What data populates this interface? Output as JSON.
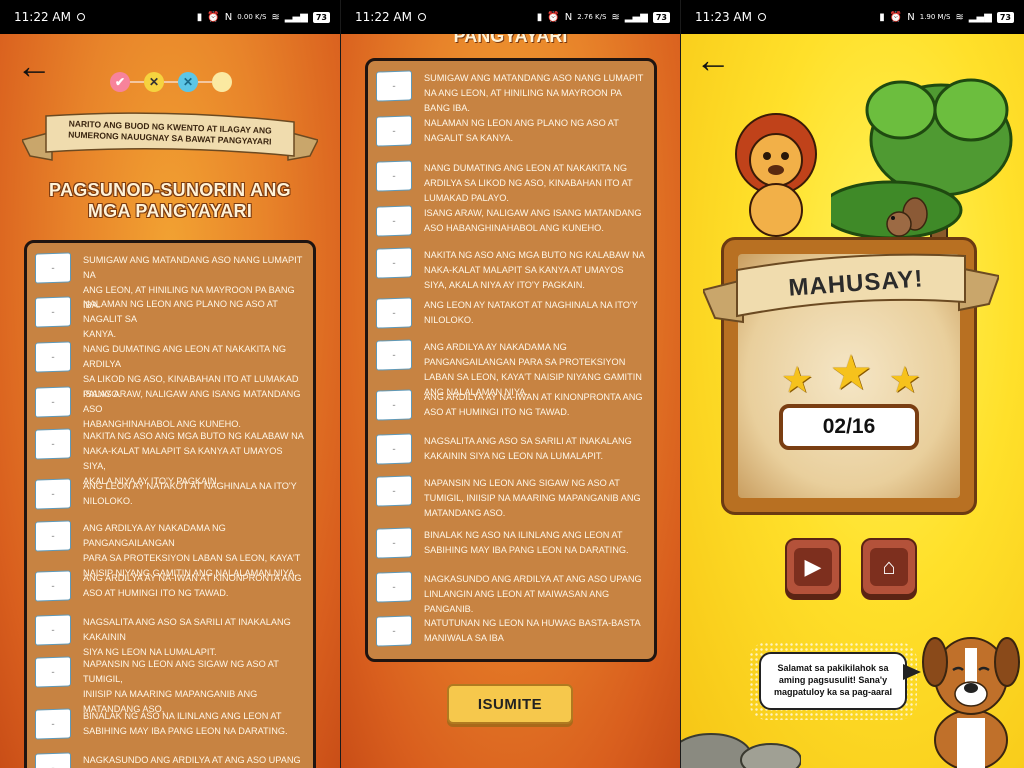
{
  "screens": [
    {
      "status": {
        "time": "11:22 AM",
        "speed": "0.00 K/S",
        "battery": "73"
      },
      "progress": [
        {
          "state": "check",
          "symbol": "✔"
        },
        {
          "state": "wrong",
          "symbol": "✕"
        },
        {
          "state": "wrong",
          "symbol": "✕"
        },
        {
          "state": "current",
          "symbol": ""
        }
      ],
      "banner_text": "NARITO ANG BUOD NG KWENTO AT ILAGAY ANG NUMERONG NAUUGNAY SA BAWAT PANGYAYARI",
      "title_line1": "PAGSUNOD-SUNORIN ANG",
      "title_line2": "MGA PANGYAYARI"
    },
    {
      "status": {
        "time": "11:22 AM",
        "speed": "2.76 K/S",
        "battery": "73"
      },
      "title_fragment": "PANGYAYARI",
      "submit_label": "ISUMITE"
    },
    {
      "status": {
        "time": "11:23 AM",
        "speed": "1.90 M/S",
        "battery": "73"
      },
      "heading": "MAHUSAY!",
      "stars": 3,
      "score": "02/16",
      "speech": "Salamat sa pakikilahok sa aming pagsusulit! Sana'y magpatuloy ka sa pag-aaral"
    }
  ],
  "slot_placeholder": "-",
  "events": [
    "SUMIGAW ANG MATANDANG ASO NANG LUMAPIT NA ANG LEON, AT HINILING NA MAYROON PA BANG IBA.",
    "NALAMAN NG LEON ANG PLANO NG ASO AT NAGALIT SA KANYA.",
    "NANG DUMATING ANG LEON AT NAKAKITA NG ARDILYA SA LIKOD NG ASO, KINABAHAN ITO AT LUMAKAD PALAYO.",
    "ISANG ARAW, NALIGAW ANG ISANG MATANDANG ASO HABANGHINAHABOL ANG KUNEHO.",
    "NAKITA NG ASO ANG MGA BUTO NG KALABAW NA NAKA-KALAT MALAPIT SA KANYA AT UMAYOS SIYA, AKALA NIYA AY ITO'Y PAGKAIN.",
    "ANG LEON AY NATAKOT AT NAGHINALA NA ITO'Y NILOLOKO.",
    "ANG ARDILYA AY NAKADAMA NG PANGANGAILANGAN PARA SA PROTEKSIYON LABAN SA LEON, KAYA'T NAISIP NIYANG GAMITIN ANG NALALAMAN NIYA.",
    "ANG ARDILYA AY NA-IWAN AT KINONPRONTA ANG ASO AT HUMINGI ITO NG TAWAD.",
    "NAGSALITA ANG ASO SA SARILI AT INAKALANG KAKAININ SIYA NG LEON NA LUMALAPIT.",
    "NAPANSIN NG LEON ANG SIGAW NG ASO AT TUMIGIL, INIISIP NA MAARING MAPANGANIB ANG MATANDANG ASO.",
    "BINALAK NG ASO NA ILINLANG ANG LEON AT SABIHING MAY IBA PANG LEON NA DARATING.",
    "NAGKASUNDO ANG ARDILYA AT ANG ASO UPANG LINLANGIN ANG LEON AT MAIWASAN ANG PANGANIB.",
    "NATUTUNAN NG LEON NA HUWAG BASTA-BASTA MANIWALA SA IBA"
  ],
  "events_s1_lines": [
    [
      "SUMIGAW ANG MATANDANG ASO NANG LUMAPIT NA",
      "ANG LEON, AT HINILING NA MAYROON PA BANG IBA."
    ],
    [
      "NALAMAN NG LEON ANG PLANO NG ASO AT NAGALIT SA",
      "KANYA."
    ],
    [
      "NANG DUMATING ANG LEON AT NAKAKITA NG ARDILYA",
      "SA LIKOD NG ASO, KINABAHAN ITO AT LUMAKAD PALAYO."
    ],
    [
      "ISANG ARAW, NALIGAW ANG ISANG MATANDANG ASO",
      "HABANGHINAHABOL ANG KUNEHO."
    ],
    [
      "NAKITA NG ASO ANG MGA BUTO NG KALABAW NA",
      "NAKA-KALAT MALAPIT SA KANYA AT UMAYOS SIYA,",
      "AKALA NIYA AY ITO'Y PAGKAIN."
    ],
    [
      "ANG LEON AY NATAKOT AT NAGHINALA NA ITO'Y",
      "NILOLOKO."
    ],
    [
      "ANG ARDILYA AY NAKADAMA NG PANGANGAILANGAN",
      "PARA SA PROTEKSIYON LABAN SA LEON, KAYA'T",
      "NAISIP NIYANG GAMITIN ANG NALALAMAN NIYA."
    ],
    [
      "ANG ARDILYA AY NA-IWAN AT KINONPRONTA ANG",
      "ASO AT HUMINGI ITO NG TAWAD."
    ],
    [
      "NAGSALITA ANG ASO SA SARILI AT INAKALANG KAKAININ",
      "SIYA NG LEON NA LUMALAPIT."
    ],
    [
      "NAPANSIN NG LEON ANG SIGAW NG ASO AT TUMIGIL,",
      "INIISIP NA MAARING MAPANGANIB ANG",
      "MATANDANG ASO."
    ],
    [
      "BINALAK NG ASO NA ILINLANG ANG LEON AT",
      "SABIHING MAY IBA PANG LEON NA DARATING."
    ],
    [
      "NAGKASUNDO ANG ARDILYA AT ANG ASO UPANG"
    ]
  ],
  "colors": {
    "orange": "#e8842a",
    "panel": "#c78342",
    "yellow": "#ffe02a",
    "button": "#f6c84c"
  }
}
